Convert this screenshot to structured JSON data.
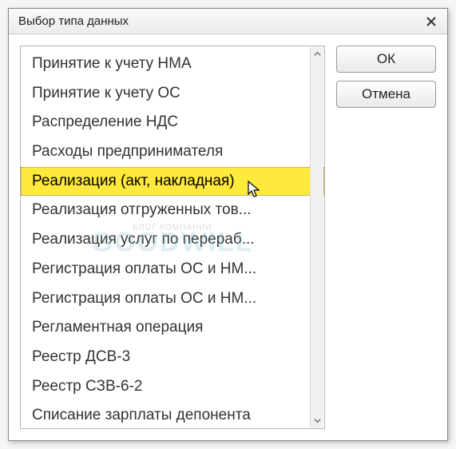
{
  "dialog": {
    "title": "Выбор типа данных"
  },
  "list": {
    "items": [
      "Принятие к учету НМА",
      "Принятие к учету ОС",
      "Распределение НДС",
      "Расходы предпринимателя",
      "Реализация (акт, накладная)",
      "Реализация отгруженных тов...",
      "Реализация услуг по перераб...",
      "Регистрация оплаты ОС и НМ...",
      "Регистрация оплаты ОС и НМ...",
      "Регламентная операция",
      "Реестр ДСВ-3",
      "Реестр СЗВ-6-2",
      "Списание зарплаты депонента"
    ],
    "selected_index": 4
  },
  "buttons": {
    "ok": "ОК",
    "cancel": "Отмена"
  },
  "watermark": {
    "sub": "БЛОГ КОМПАНИИ",
    "main": "GOODWILL"
  }
}
